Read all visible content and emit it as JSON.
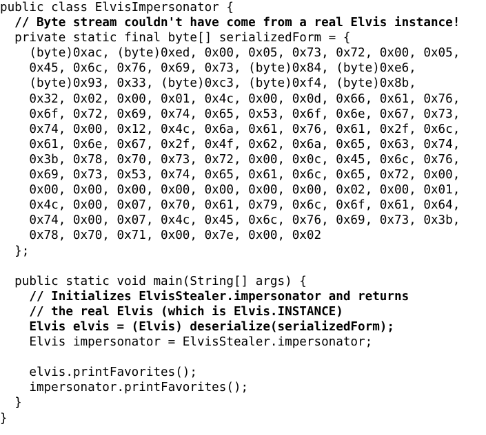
{
  "document": {
    "lines": [
      {
        "text": "public class ElvisImpersonator {",
        "bold": false
      },
      {
        "text": "  // Byte stream couldn't have come from a real Elvis instance!",
        "bold": true
      },
      {
        "text": "  private static final byte[] serializedForm = {",
        "bold": false
      },
      {
        "text": "    (byte)0xac, (byte)0xed, 0x00, 0x05, 0x73, 0x72, 0x00, 0x05,",
        "bold": false
      },
      {
        "text": "    0x45, 0x6c, 0x76, 0x69, 0x73, (byte)0x84, (byte)0xe6,",
        "bold": false
      },
      {
        "text": "    (byte)0x93, 0x33, (byte)0xc3, (byte)0xf4, (byte)0x8b,",
        "bold": false
      },
      {
        "text": "    0x32, 0x02, 0x00, 0x01, 0x4c, 0x00, 0x0d, 0x66, 0x61, 0x76,",
        "bold": false
      },
      {
        "text": "    0x6f, 0x72, 0x69, 0x74, 0x65, 0x53, 0x6f, 0x6e, 0x67, 0x73,",
        "bold": false
      },
      {
        "text": "    0x74, 0x00, 0x12, 0x4c, 0x6a, 0x61, 0x76, 0x61, 0x2f, 0x6c,",
        "bold": false
      },
      {
        "text": "    0x61, 0x6e, 0x67, 0x2f, 0x4f, 0x62, 0x6a, 0x65, 0x63, 0x74,",
        "bold": false
      },
      {
        "text": "    0x3b, 0x78, 0x70, 0x73, 0x72, 0x00, 0x0c, 0x45, 0x6c, 0x76,",
        "bold": false
      },
      {
        "text": "    0x69, 0x73, 0x53, 0x74, 0x65, 0x61, 0x6c, 0x65, 0x72, 0x00,",
        "bold": false
      },
      {
        "text": "    0x00, 0x00, 0x00, 0x00, 0x00, 0x00, 0x00, 0x02, 0x00, 0x01,",
        "bold": false
      },
      {
        "text": "    0x4c, 0x00, 0x07, 0x70, 0x61, 0x79, 0x6c, 0x6f, 0x61, 0x64,",
        "bold": false
      },
      {
        "text": "    0x74, 0x00, 0x07, 0x4c, 0x45, 0x6c, 0x76, 0x69, 0x73, 0x3b,",
        "bold": false
      },
      {
        "text": "    0x78, 0x70, 0x71, 0x00, 0x7e, 0x00, 0x02",
        "bold": false
      },
      {
        "text": "  };",
        "bold": false
      },
      {
        "text": "",
        "bold": false
      },
      {
        "text": "  public static void main(String[] args) {",
        "bold": false
      },
      {
        "text": "    // Initializes ElvisStealer.impersonator and returns",
        "bold": true
      },
      {
        "text": "    // the real Elvis (which is Elvis.INSTANCE)",
        "bold": true
      },
      {
        "text": "    Elvis elvis = (Elvis) deserialize(serializedForm);",
        "bold": true
      },
      {
        "text": "    Elvis impersonator = ElvisStealer.impersonator;",
        "bold": false
      },
      {
        "text": "",
        "bold": false
      },
      {
        "text": "    elvis.printFavorites();",
        "bold": false
      },
      {
        "text": "    impersonator.printFavorites();",
        "bold": false
      },
      {
        "text": "  }",
        "bold": false
      },
      {
        "text": "}",
        "bold": false
      }
    ]
  }
}
